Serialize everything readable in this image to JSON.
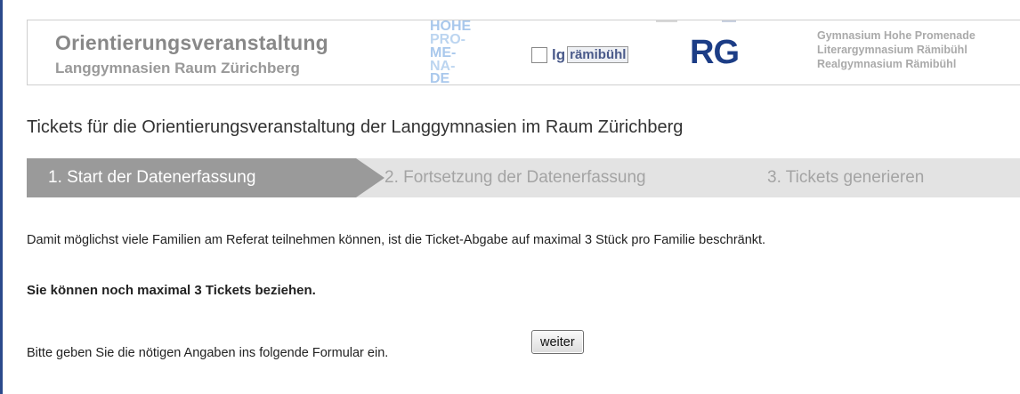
{
  "header": {
    "event_title": "Orientierungsveranstaltung",
    "event_subtitle": "Langgymnasien Raum Zürichberg",
    "hope_logo_text": [
      "HOHE",
      "PRO-",
      "ME-",
      "NA-",
      "DE"
    ],
    "lg_logo": {
      "prefix": "lg",
      "name": "rämibühl"
    },
    "rg_logo": "RG",
    "schools": [
      "Gymnasium Hohe Promenade",
      "Literargymnasium Rämibühl",
      "Realgymnasium Rämibühl"
    ]
  },
  "page_title": "Tickets für die Orientierungsveranstaltung der Langgymnasien im Raum Zürichberg",
  "steps": [
    {
      "label": "1. Start der Datenerfassung",
      "active": true
    },
    {
      "label": "2. Fortsetzung der Datenerfassung",
      "active": false
    },
    {
      "label": "3. Tickets generieren",
      "active": false
    }
  ],
  "info_text": "Damit möglichst viele Familien am Referat teilnehmen können, ist die Ticket-Abgabe auf maximal 3 Stück pro Familie beschränkt.",
  "remaining_text": "Sie können noch maximal 3 Tickets beziehen.",
  "instruction_text": "Bitte geben Sie die nötigen Angaben ins folgende Formular ein.",
  "continue_button": "weiter",
  "colors": {
    "rg_blue": "#1c3d86",
    "hope_blue": "#a9c8ec",
    "active_step": "#9a9a9a",
    "step_bar": "#e3e3e3"
  }
}
